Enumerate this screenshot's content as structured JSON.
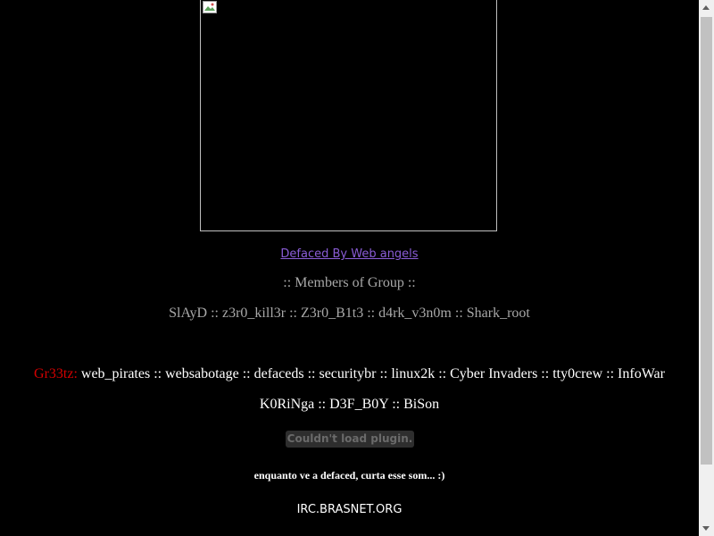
{
  "image": {
    "icon": "broken-image-icon"
  },
  "link": {
    "text": "Defaced By Web angels",
    "color": "#8a5cd6"
  },
  "members": {
    "heading": ":: Members of Group ::",
    "list": "SlAyD :: z3r0_kill3r :: Z3r0_B1t3 :: d4rk_v3n0m :: Shark_root"
  },
  "greetz": {
    "label": "Gr33tz:",
    "line1": " web_pirates :: websabotage :: defaceds :: securitybr :: linux2k :: Cyber Invaders :: tty0crew :: InfoWar",
    "line2": "K0RiNga :: D3F_B0Y :: BiSon",
    "label_color": "#d40000"
  },
  "plugin": {
    "message": "Couldn't load plugin."
  },
  "song": {
    "text": "enquanto ve a defaced, curta esse som... :)"
  },
  "irc": {
    "text": "IRC.BRASNET.ORG"
  },
  "scrollbar": {
    "up_icon": "scroll-up-arrow-icon",
    "down_icon": "scroll-down-arrow-icon"
  }
}
